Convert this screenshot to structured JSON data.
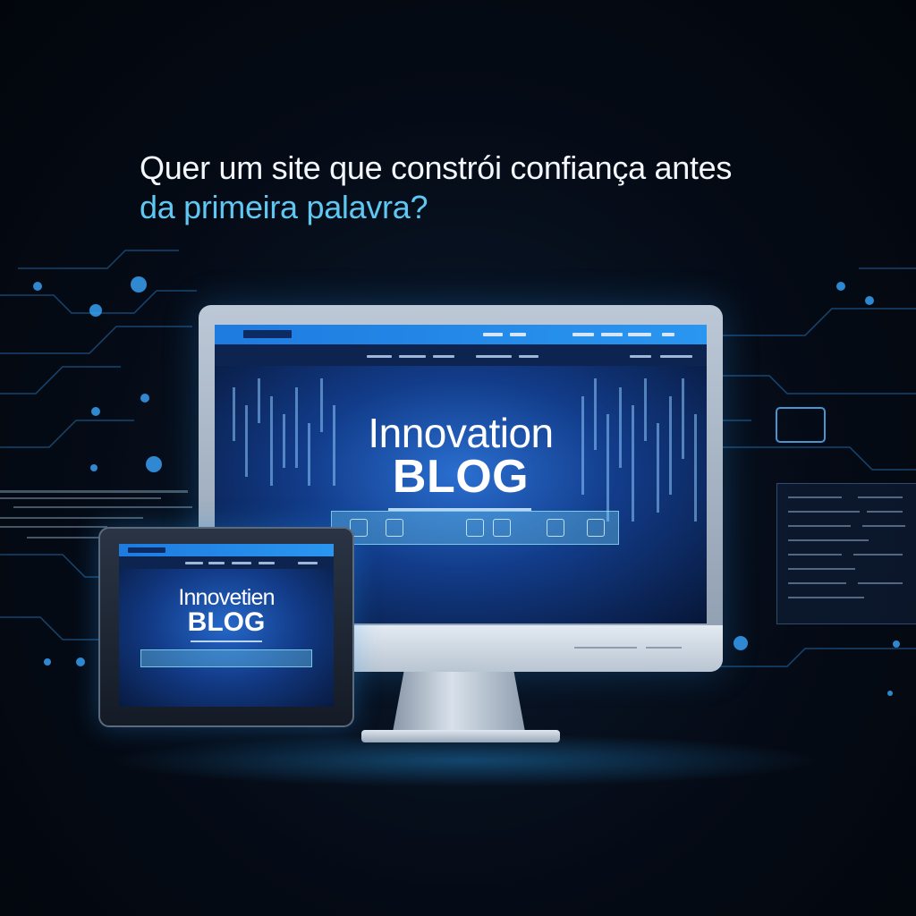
{
  "headline": {
    "line1": "Quer um site que constrói confiança antes",
    "line2": "da primeira palavra?"
  },
  "monitor": {
    "hero_line1": "Innovation",
    "hero_line2": "BLOG"
  },
  "tablet": {
    "hero_line1": "Innovetien",
    "hero_line2": "BLOG"
  },
  "colors": {
    "background": "#050b16",
    "headline_primary": "#f4f7fb",
    "headline_accent": "#5ec8f2",
    "nav_blue": "#1e7be0",
    "circuit": "#2f8fe0"
  },
  "icons": [
    "circuit-node-icon",
    "gear-icon",
    "chip-icon",
    "cloud-icon"
  ]
}
